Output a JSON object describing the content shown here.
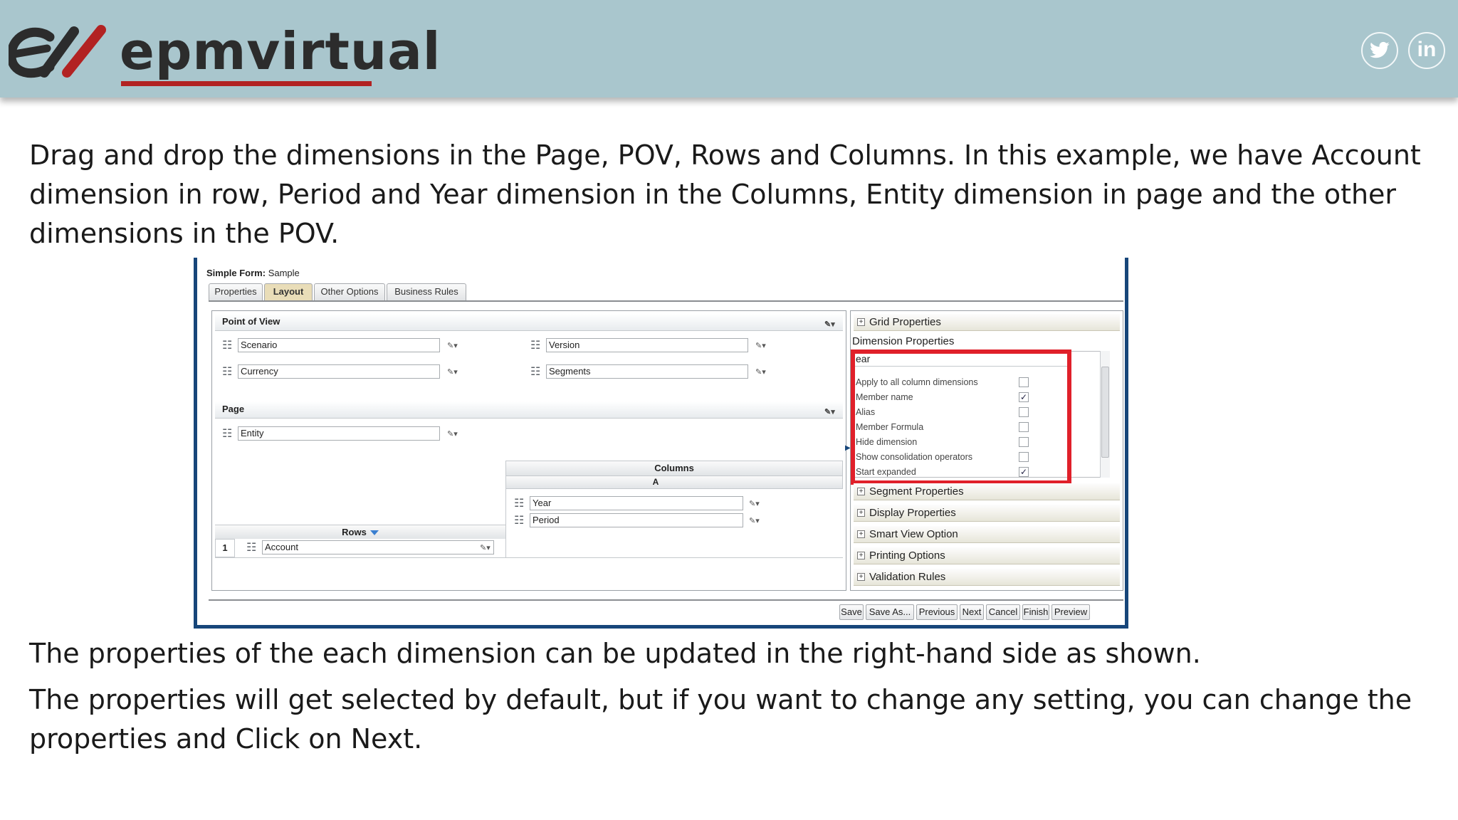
{
  "header": {
    "logo_text": "epmvirtual",
    "social": [
      {
        "icon": "twitter-icon",
        "glyph": "✦"
      },
      {
        "icon": "linkedin-icon",
        "glyph": "in"
      }
    ],
    "background_color": "#a9c6cd"
  },
  "slide": {
    "intro": "Drag and drop the dimensions in the Page, POV, Rows and Columns. In this example, we have Account dimension in row, Period and Year dimension in the Columns, Entity dimension in page and the other dimensions in the POV.",
    "note1": "The properties of the each dimension can be updated in the right-hand side as shown.",
    "note2": "The properties will get selected by default, but if you want to change any setting, you can change the properties and Click on Next."
  },
  "form": {
    "title_label": "Simple Form:",
    "title_value": "Sample",
    "tabs": [
      {
        "label": "Properties",
        "active": false
      },
      {
        "label": "Layout",
        "active": true
      },
      {
        "label": "Other Options",
        "active": false
      },
      {
        "label": "Business Rules",
        "active": false
      }
    ],
    "pov": {
      "label": "Point of View",
      "dimensions": [
        "Scenario",
        "Version",
        "Currency",
        "Segments"
      ]
    },
    "page": {
      "label": "Page",
      "dimensions": [
        "Entity"
      ]
    },
    "columns": {
      "label": "Columns",
      "segment": "A",
      "dimensions": [
        "Year",
        "Period"
      ]
    },
    "rows": {
      "label": "Rows",
      "row_number": "1",
      "dimensions": [
        "Account"
      ]
    },
    "right_panel": {
      "grid_properties": "Grid Properties",
      "dimension_properties": "Dimension Properties",
      "selected_dimension": "ear",
      "properties": [
        {
          "label": "Apply to all column dimensions",
          "checked": false
        },
        {
          "label": "Member name",
          "checked": true
        },
        {
          "label": "Alias",
          "checked": false
        },
        {
          "label": "Member Formula",
          "checked": false
        },
        {
          "label": "Hide dimension",
          "checked": false
        },
        {
          "label": "Show consolidation operators",
          "checked": false
        },
        {
          "label": "Start expanded",
          "checked": true
        }
      ],
      "sections": [
        "Segment Properties",
        "Display Properties",
        "Smart View Option",
        "Printing Options",
        "Validation Rules"
      ],
      "highlight_color": "#e0202a"
    },
    "buttons": [
      "Save",
      "Save As...",
      "Previous",
      "Next",
      "Cancel",
      "Finish",
      "Preview"
    ]
  }
}
